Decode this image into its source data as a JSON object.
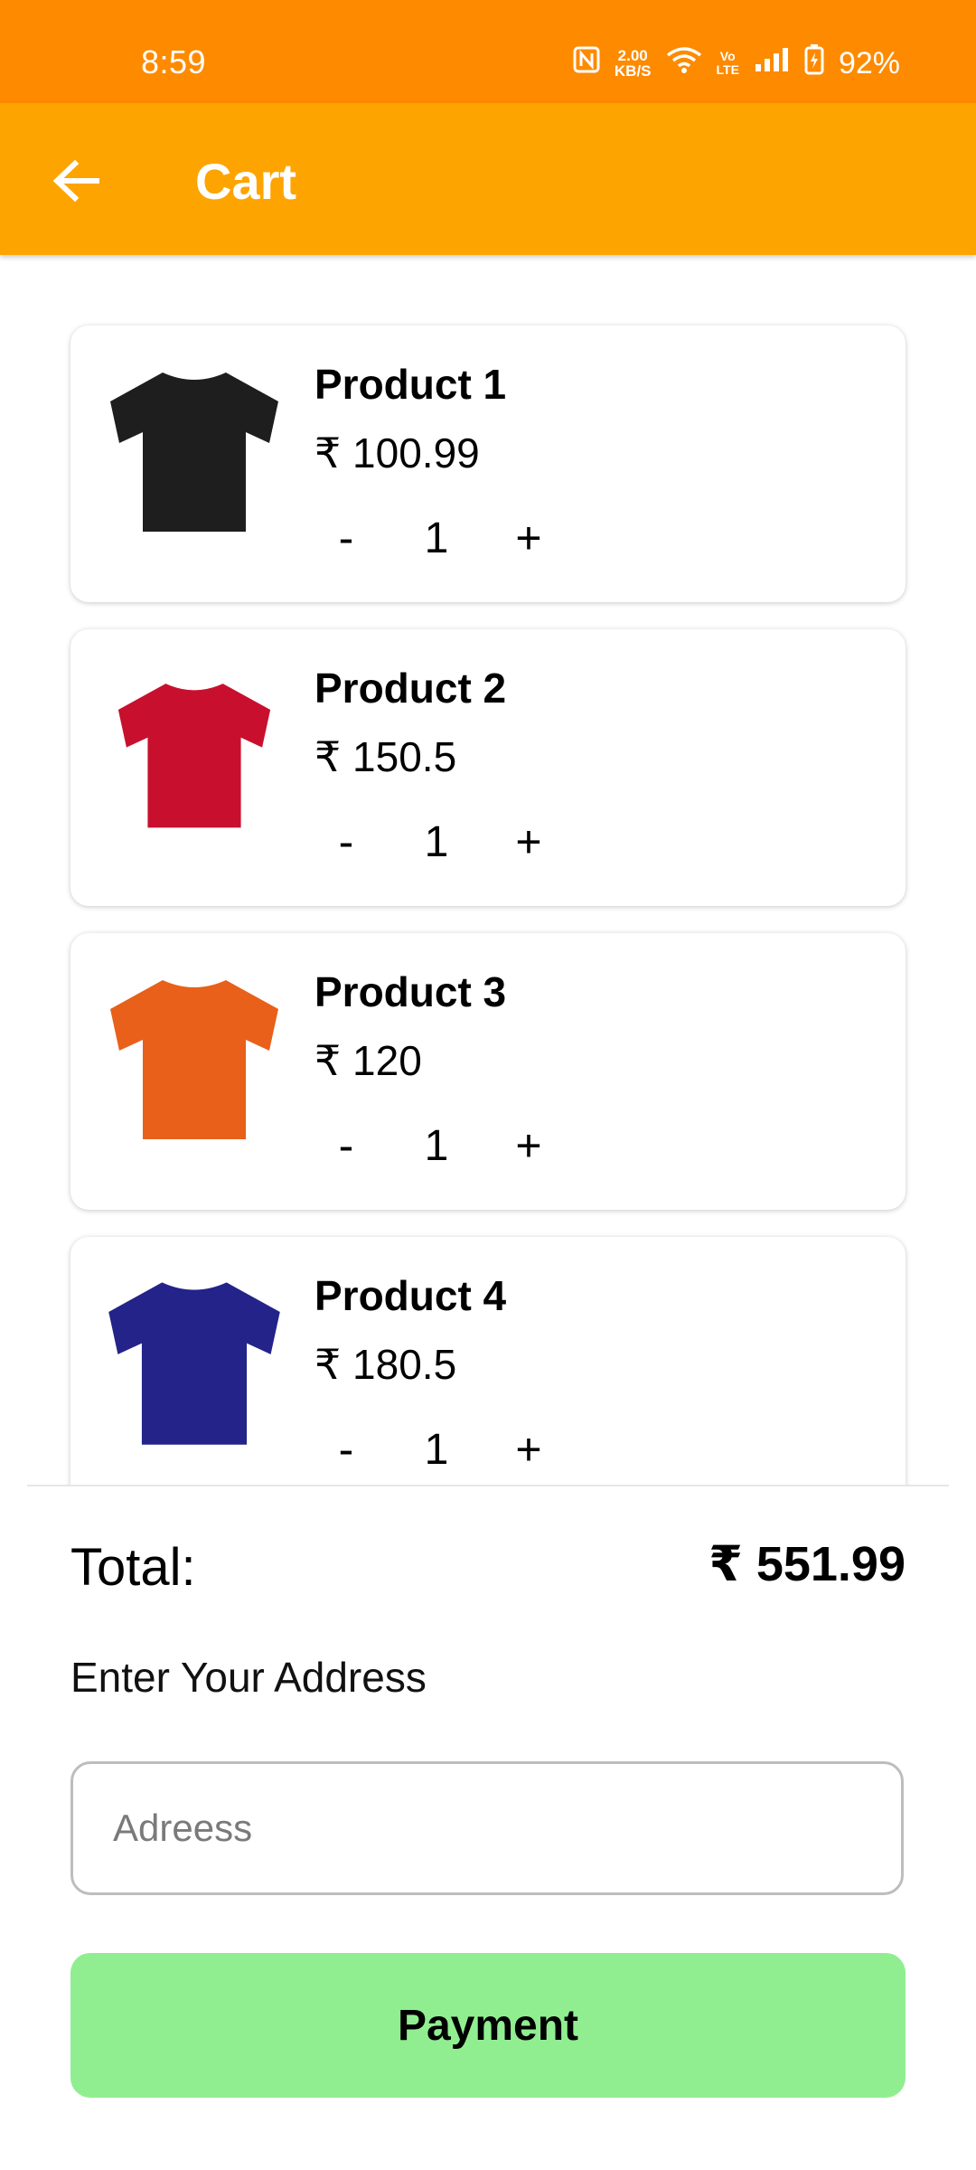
{
  "status_bar": {
    "time": "8:59",
    "net_speed_value": "2.00",
    "net_speed_unit": "KB/S",
    "volte_top": "Vo",
    "volte_bottom": "LTE",
    "battery": "92%",
    "icons": [
      "nfc-icon",
      "wifi-icon",
      "volte-icon",
      "signal-icon",
      "battery-icon"
    ]
  },
  "header": {
    "title": "Cart",
    "back_icon": "arrow-left-icon"
  },
  "colors": {
    "status_bar": "#fe8a00",
    "app_bar": "#fea400",
    "payment_button": "#90ee90"
  },
  "cart": {
    "items": [
      {
        "name": "Product 1",
        "price": "₹ 100.99",
        "quantity": "1",
        "minus": "-",
        "plus": "+",
        "shirt_color": "#1e1e1e",
        "image_icon": "tshirt-icon"
      },
      {
        "name": "Product 2",
        "price": "₹ 150.5",
        "quantity": "1",
        "minus": "-",
        "plus": "+",
        "shirt_color": "#c8102e",
        "image_icon": "tshirt-icon"
      },
      {
        "name": "Product 3",
        "price": "₹ 120",
        "quantity": "1",
        "minus": "-",
        "plus": "+",
        "shirt_color": "#e8601a",
        "image_icon": "tshirt-icon"
      },
      {
        "name": "Product 4",
        "price": "₹ 180.5",
        "quantity": "1",
        "minus": "-",
        "plus": "+",
        "shirt_color": "#23238a",
        "image_icon": "tshirt-icon"
      }
    ]
  },
  "summary": {
    "total_label": "Total:",
    "total_value": "₹ 551.99"
  },
  "address": {
    "label": "Enter Your Address",
    "placeholder": "Adreess",
    "value": ""
  },
  "payment": {
    "label": "Payment"
  }
}
